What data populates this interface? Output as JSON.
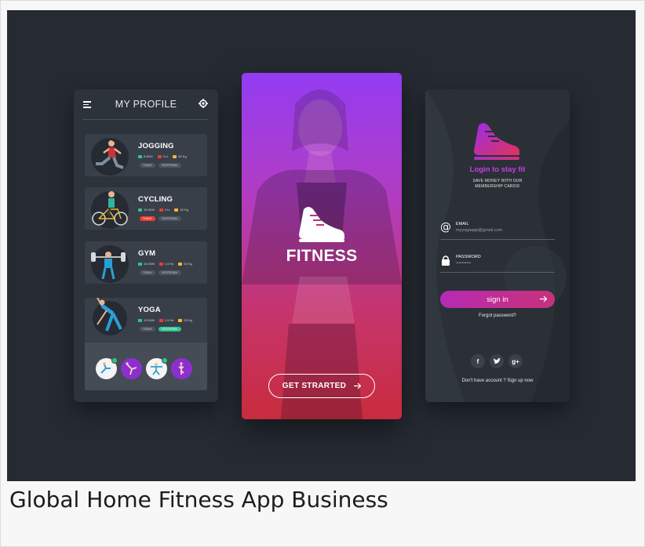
{
  "caption": "Global Home Fitness App Business",
  "colors": {
    "background": "#262b33",
    "panel": "#2d333b",
    "accent_purple": "#8a2bf2",
    "accent_pink": "#ec3348",
    "tag_red": "#ee3b35",
    "tag_green": "#2fc48f"
  },
  "profile": {
    "title": "MY PROFILE",
    "menu_icon": "hamburger-menu-icon",
    "settings_icon": "gear-icon",
    "activities": [
      {
        "name": "JOGGING",
        "stats": [
          "8.5KM",
          "3 Lt",
          "52 Kg"
        ],
        "tags": [
          "TODAY",
          "YESTERDAY"
        ],
        "active_tag": "none"
      },
      {
        "name": "CYCLING",
        "stats": [
          "10.0KM",
          "3 Lt",
          "52 Kg"
        ],
        "tags": [
          "TODAY",
          "YESTERDAY"
        ],
        "active_tag": "red"
      },
      {
        "name": "GYM",
        "stats": [
          "10.0KM",
          "1.5 Hz",
          "52 Kg"
        ],
        "tags": [
          "TODAY",
          "YESTERDAY"
        ],
        "active_tag": "none"
      },
      {
        "name": "YOGA",
        "stats": [
          "10.0KM",
          "1.5 Hz",
          "52 Kg"
        ],
        "tags": [
          "TODAY",
          "YESTERDAY"
        ],
        "active_tag": "green"
      }
    ],
    "poses": [
      "pose-1",
      "pose-2",
      "pose-3",
      "pose-4"
    ]
  },
  "fitness": {
    "title": "FITNESS",
    "start_button": "GET STRARTED"
  },
  "login": {
    "title": "Login to stay fit",
    "subtitle": "SAVE MONEY WITH OUR MEMBERSHIP CARDS!",
    "email_label": "EMAIL",
    "email_value": "myyogaapp@gmail.com",
    "password_label": "PASSWORD",
    "password_value": "••••••••••",
    "signin_button": "sign in",
    "forgot": "Forgot password?",
    "social": [
      "f",
      "t",
      "g+"
    ],
    "signup": "Don't have account ? Sign up now"
  }
}
